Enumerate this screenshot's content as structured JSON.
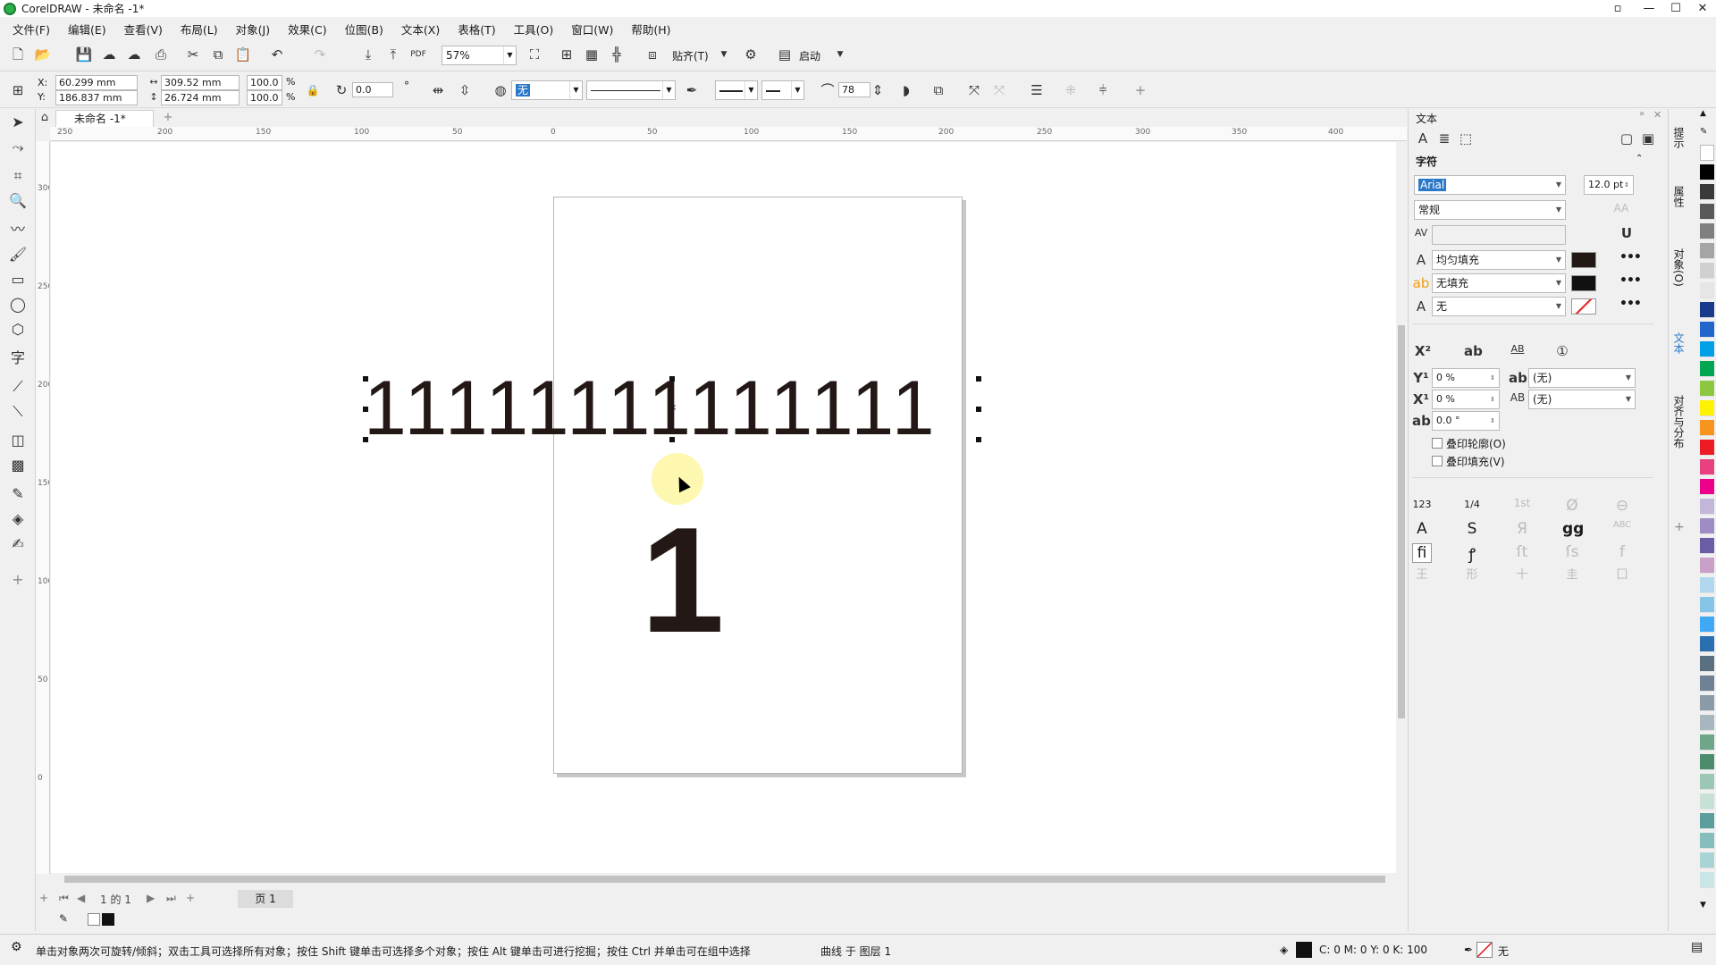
{
  "window": {
    "title": "CorelDRAW - 未命名 -1*",
    "controls": [
      "▫",
      "—",
      "☐",
      "✕"
    ]
  },
  "menu": [
    "文件(F)",
    "编辑(E)",
    "查看(V)",
    "布局(L)",
    "对象(J)",
    "效果(C)",
    "位图(B)",
    "文本(X)",
    "表格(T)",
    "工具(O)",
    "窗口(W)",
    "帮助(H)"
  ],
  "toolbar1": {
    "zoom": "57%",
    "snap_label": "贴齐(T)",
    "launch_label": "启动"
  },
  "property_bar": {
    "x_label": "X:",
    "x_value": "60.299 mm",
    "y_label": "Y:",
    "y_value": "186.837 mm",
    "width_value": "309.52 mm",
    "height_value": "26.724 mm",
    "scale_w": "100.0",
    "scale_h": "100.0",
    "percent": "%",
    "rotation": "0.0",
    "degree": "°",
    "fill_value": "无",
    "miter": "78"
  },
  "document": {
    "tab_label": "未命名 -1*"
  },
  "ruler": {
    "h_labels": [
      "250",
      "200",
      "150",
      "100",
      "50",
      "0",
      "50",
      "100",
      "150",
      "200",
      "250",
      "300",
      "350",
      "400"
    ],
    "v_labels": [
      "300",
      "250",
      "200",
      "150",
      "100",
      "50",
      "0"
    ]
  },
  "canvas": {
    "ones_row": "11111111111111",
    "big_digit": "1"
  },
  "pagenav": {
    "page_of": "1 的 1",
    "page_tab": "页 1"
  },
  "status": {
    "hint": "单击对象两次可旋转/倾斜；双击工具可选择所有对象；按住 Shift 键单击可选择多个对象；按住 Alt 键单击可进行挖掘；按住 Ctrl 并单击可在组中选择",
    "object_info": "曲线 于 图层 1",
    "cmyk": "C: 0 M: 0 Y: 0 K: 100",
    "outline": "无"
  },
  "docker": {
    "title": "文本",
    "section": "字符",
    "font": "Arial",
    "font_size": "12.0 pt",
    "font_style": "常规",
    "fill_label": "均匀填充",
    "bg_fill_label": "无填充",
    "outline_label": "无",
    "y_offset": "0 %",
    "x_offset": "0 %",
    "angle": "0.0 °",
    "none1": "(无)",
    "none2": "(无)",
    "overprint_outline": "叠印轮廓(O)",
    "overprint_fill": "叠印填充(V)"
  },
  "side_tabs": [
    "提示",
    "属性",
    "对象(O)",
    "文本",
    "对齐与分布"
  ],
  "colors": {
    "accent": "#2b78c8",
    "text_dark": "#231815",
    "halo": "#fdf7b0",
    "palette": [
      "#ffffff",
      "#000000",
      "#3a3a3a",
      "#595959",
      "#7f7f7f",
      "#a5a5a5",
      "#d0d0d0",
      "#e6e6e6",
      "#1a3a8c",
      "#2266cc",
      "#00a0e9",
      "#00a651",
      "#8dc63f",
      "#fff200",
      "#f7941d",
      "#ed1c24",
      "#e8417f",
      "#ec008c",
      "#c2b7d9",
      "#9e8dc4",
      "#6c5ba7",
      "#c8a0c8",
      "#b2d8f0",
      "#86c5e8",
      "#3fa9f5",
      "#2a6fb0",
      "#587080",
      "#6e8294",
      "#899aa8",
      "#a8b6c0",
      "#6fa68a",
      "#4c8c6c",
      "#9bc7b4",
      "#c7e2d4",
      "#5c9e9e",
      "#86bebe",
      "#a9d4d4",
      "#c9e6e6"
    ]
  }
}
